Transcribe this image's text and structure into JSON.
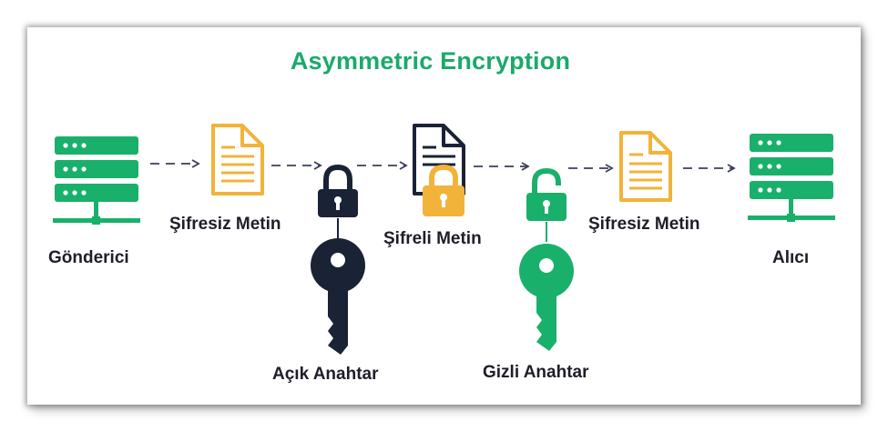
{
  "title": "Asymmetric Encryption",
  "labels": {
    "sender": "Gönderici",
    "plaintext_1": "Şifresiz Metin",
    "public_key": "Açık Anahtar",
    "ciphertext": "Şifreli Metin",
    "private_key": "Gizli Anahtar",
    "plaintext_2": "Şifresiz Metin",
    "receiver": "Alıcı"
  },
  "colors": {
    "green": "#19b06b",
    "yellow": "#f2b33a",
    "navy": "#1a2236",
    "arrow": "#3b3f5c",
    "title": "#1aaa6a"
  },
  "icons": [
    "server-icon",
    "document-icon",
    "padlock-icon",
    "key-icon",
    "arrow-icon"
  ]
}
